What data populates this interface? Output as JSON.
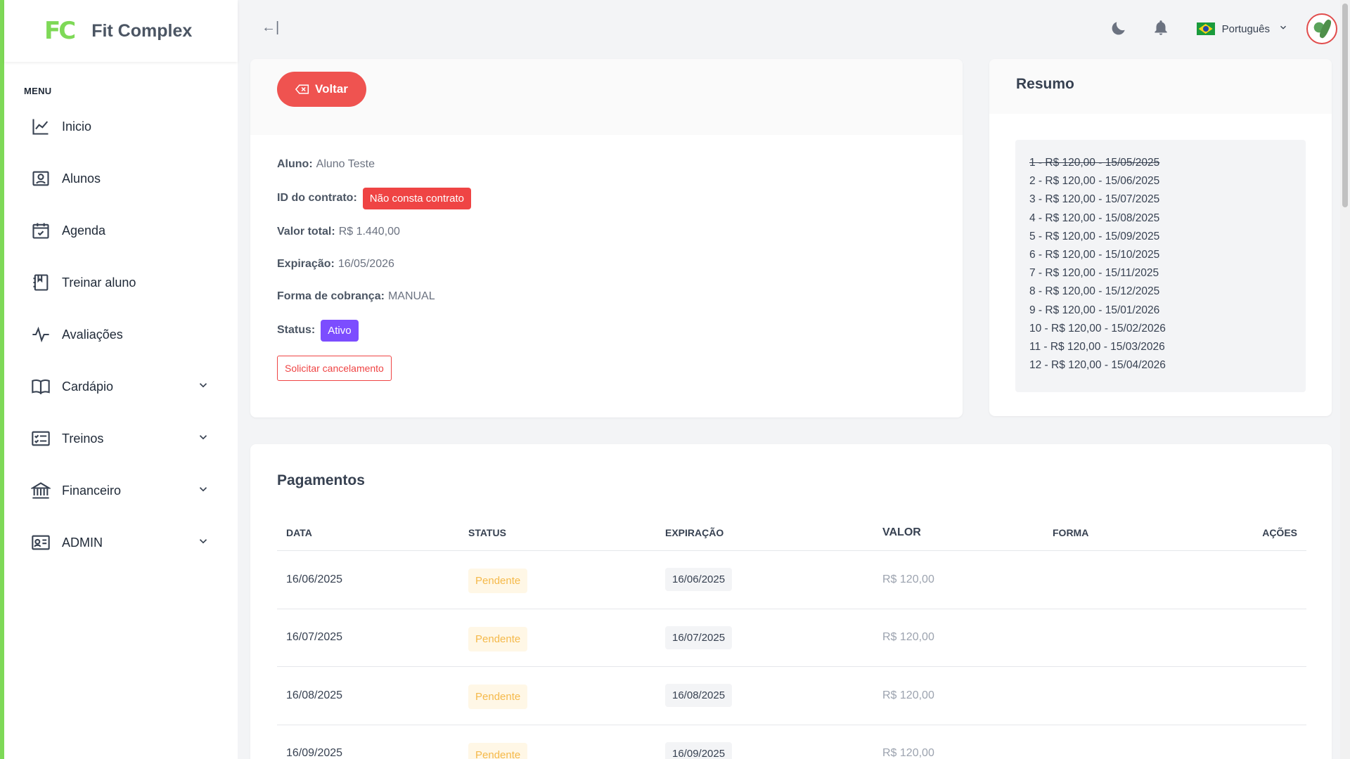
{
  "brand": {
    "logo": "FC",
    "name": "Fit Complex"
  },
  "menu": {
    "heading": "MENU",
    "items": [
      {
        "label": "Inicio",
        "icon": "chart-line-icon",
        "expandable": false
      },
      {
        "label": "Alunos",
        "icon": "user-square-icon",
        "expandable": false
      },
      {
        "label": "Agenda",
        "icon": "calendar-check-icon",
        "expandable": false
      },
      {
        "label": "Treinar aluno",
        "icon": "bookmark-book-icon",
        "expandable": false
      },
      {
        "label": "Avaliações",
        "icon": "pulse-icon",
        "expandable": false
      },
      {
        "label": "Cardápio",
        "icon": "open-book-icon",
        "expandable": true
      },
      {
        "label": "Treinos",
        "icon": "checklist-icon",
        "expandable": true
      },
      {
        "label": "Financeiro",
        "icon": "bank-icon",
        "expandable": true
      },
      {
        "label": "ADMIN",
        "icon": "id-card-icon",
        "expandable": true
      }
    ]
  },
  "topbar": {
    "collapse_glyph": "←|",
    "language": "Português"
  },
  "contract": {
    "back_label": "Voltar",
    "aluno_label": "Aluno:",
    "aluno_value": "Aluno Teste",
    "contrato_label": "ID do contrato:",
    "contrato_value": "Não consta contrato",
    "valor_label": "Valor total:",
    "valor_value": "R$ 1.440,00",
    "expiracao_label": "Expiração:",
    "expiracao_value": "16/05/2026",
    "forma_label": "Forma de cobrança:",
    "forma_value": "MANUAL",
    "status_label": "Status:",
    "status_value": "Ativo",
    "cancel_label": "Solicitar cancelamento"
  },
  "summary": {
    "title": "Resumo",
    "installments": [
      "1 - R$ 120,00 - 15/05/2025",
      "2 - R$ 120,00 - 15/06/2025",
      "3 - R$ 120,00 - 15/07/2025",
      "4 - R$ 120,00 - 15/08/2025",
      "5 - R$ 120,00 - 15/09/2025",
      "6 - R$ 120,00 - 15/10/2025",
      "7 - R$ 120,00 - 15/11/2025",
      "8 - R$ 120,00 - 15/12/2025",
      "9 - R$ 120,00 - 15/01/2026",
      "10 - R$ 120,00 - 15/02/2026",
      "11 - R$ 120,00 - 15/03/2026",
      "12 - R$ 120,00 - 15/04/2026"
    ]
  },
  "payments": {
    "title": "Pagamentos",
    "columns": [
      "DATA",
      "STATUS",
      "EXPIRAÇÃO",
      "VALOR",
      "FORMA",
      "AÇÕES"
    ],
    "rows": [
      {
        "data": "16/06/2025",
        "status": "Pendente",
        "expiracao": "16/06/2025",
        "valor": "R$ 120,00",
        "forma": ""
      },
      {
        "data": "16/07/2025",
        "status": "Pendente",
        "expiracao": "16/07/2025",
        "valor": "R$ 120,00",
        "forma": ""
      },
      {
        "data": "16/08/2025",
        "status": "Pendente",
        "expiracao": "16/08/2025",
        "valor": "R$ 120,00",
        "forma": ""
      },
      {
        "data": "16/09/2025",
        "status": "Pendente",
        "expiracao": "16/09/2025",
        "valor": "R$ 120,00",
        "forma": ""
      }
    ]
  },
  "colors": {
    "brand_green": "#7ed957",
    "danger": "#ef5350",
    "active": "#7c4dff",
    "pending_text": "#f5b94a",
    "pending_bg": "#fff7e6"
  }
}
